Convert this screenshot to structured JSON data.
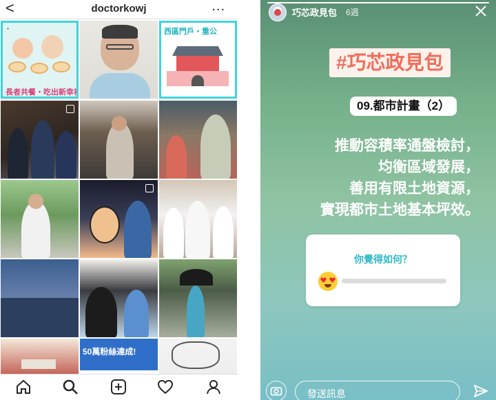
{
  "profile": {
    "username": "doctorkowj",
    "back_glyph": "<",
    "more_glyph": "...",
    "tiles": [
      {
        "kind": "illustration",
        "caption": "長者共餐・吃出新幸福",
        "icon": "elderly-meal-illustration"
      },
      {
        "kind": "photo",
        "icon": "portrait-photo"
      },
      {
        "kind": "illustration",
        "title": "西區門戶・重公",
        "icon": "west-gate-illustration"
      },
      {
        "kind": "photo",
        "icon": "press-photo"
      },
      {
        "kind": "photo",
        "icon": "reading-photo"
      },
      {
        "kind": "photo",
        "icon": "market-photo"
      },
      {
        "kind": "photo",
        "icon": "outdoor-speech-photo"
      },
      {
        "kind": "photo",
        "icon": "caricature-photo"
      },
      {
        "kind": "photo",
        "icon": "group-photo"
      },
      {
        "kind": "photo",
        "icon": "auditorium-photo"
      },
      {
        "kind": "photo",
        "icon": "bear-mascot-photo"
      },
      {
        "kind": "photo",
        "icon": "umbrella-walk-photo"
      },
      {
        "kind": "photo",
        "icon": "gate-photo"
      },
      {
        "kind": "banner",
        "text": "50萬粉絲達成!",
        "icon": "fifty-thousand-banner"
      },
      {
        "kind": "illustration",
        "icon": "sketch-illustration"
      }
    ],
    "bottom_nav": [
      "home-icon",
      "search-icon",
      "add-post-icon",
      "heart-icon",
      "profile-icon"
    ]
  },
  "story": {
    "account_name": "巧芯政見包",
    "time_ago": "6週",
    "hashtag": "#巧芯政見包",
    "chapter": "09.都市計畫（2）",
    "lines": [
      "推動容積率通盤檢討，",
      "均衡區域發展，",
      "善用有限土地資源，",
      "實現都市土地基本坪效。"
    ],
    "poll_question": "你覺得如何？",
    "poll_emoji": "heart-eyes-emoji",
    "reply_placeholder": "發送訊息",
    "progress": 1.0,
    "colors": {
      "hashtag": "#f06d5a",
      "poll_question": "#2eb8c8",
      "tile_border": "#3fd3d9",
      "tile_caption": "#d8407b"
    }
  }
}
